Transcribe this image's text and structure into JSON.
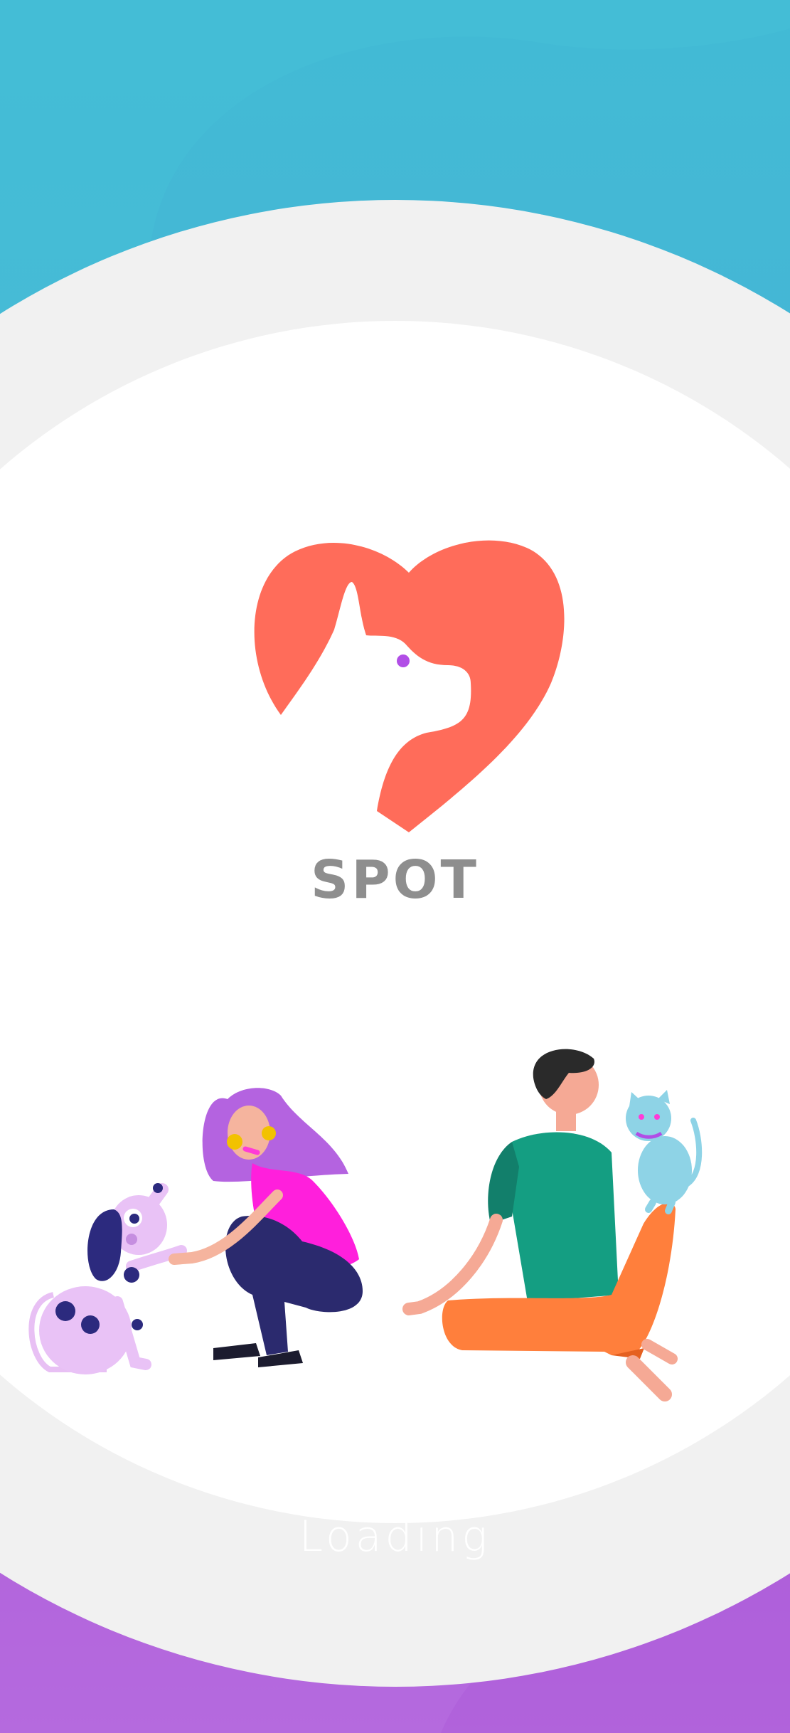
{
  "app": {
    "name": "SPOT",
    "status_text": "Loading"
  },
  "colors": {
    "sky_top": "#42BBD5",
    "sky_bottom": "#6E86D3",
    "purple": "#AB50D4",
    "light_purple": "#B76FDD",
    "ring": "#F1F1F1",
    "center": "#FFFFFF",
    "logo_heart": "#FF6C5A",
    "logo_eye": "#B14EE6",
    "brand_text": "#8E8E8E"
  },
  "illustrations": [
    "logo-heart-dog-icon",
    "spotted-dog-illustration",
    "woman-crouching-illustration",
    "man-sitting-illustration",
    "blue-cat-illustration"
  ]
}
